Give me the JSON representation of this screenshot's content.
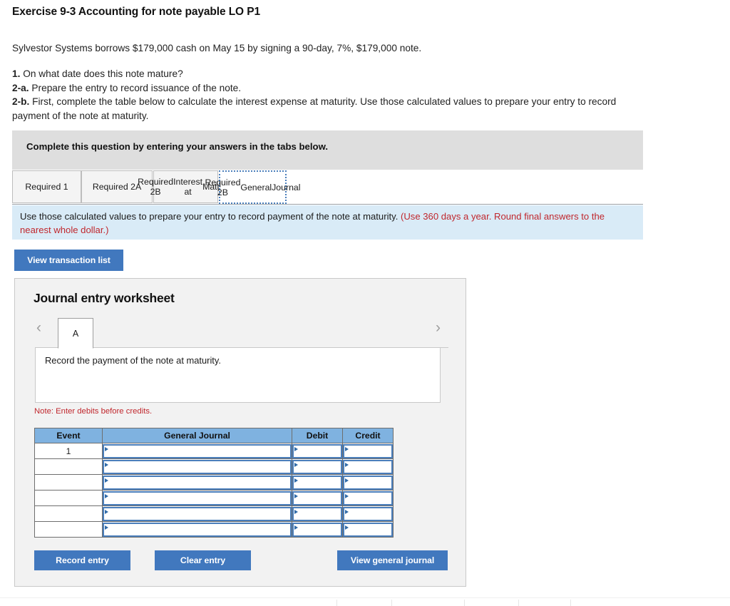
{
  "exercise": {
    "title": "Exercise 9-3 Accounting for note payable LO P1",
    "problem": "Sylvestor Systems borrows $179,000 cash on May 15 by signing a 90-day, 7%, $179,000 note.",
    "requirements": [
      {
        "label": "1.",
        "text": " On what date does this note mature?"
      },
      {
        "label": "2-a.",
        "text": " Prepare the entry to record issuance of the note."
      },
      {
        "label": "2-b.",
        "text": " First, complete the table below to calculate the interest expense at maturity. Use those calculated values to prepare your entry to record payment of the note at maturity."
      }
    ]
  },
  "instruction_banner": {
    "text": "Complete this question by entering your answers in the tabs below."
  },
  "tabs": [
    {
      "id": "tab0",
      "label": "Required 1",
      "active": false
    },
    {
      "id": "tab1",
      "label": "Required 2A",
      "active": false
    },
    {
      "id": "tab2",
      "label": "Required 2B Interest at Maturity",
      "line1": "Required 2B",
      "line2": "Interest at",
      "line3": "Maturity",
      "active": false
    },
    {
      "id": "tab3",
      "label": "Required 2B General Journal",
      "line1": "Required 2B",
      "line2": "General",
      "line3": "Journal",
      "active": true
    }
  ],
  "info_banner": {
    "text": "Use those calculated values to prepare your entry to record payment of the note at maturity. ",
    "hint": "(Use 360 days a year. Round final answers to the nearest whole dollar.)",
    "hint_color": "#c0272d"
  },
  "buttons": {
    "view_transaction_list": "View transaction list",
    "record_entry": "Record entry",
    "clear_entry": "Clear entry",
    "view_general_journal": "View general journal",
    "primary_color": "#4178be"
  },
  "worksheet": {
    "title": "Journal entry worksheet",
    "prev_icon": "chevron-left-icon",
    "next_icon": "chevron-right-icon",
    "entry_tabs": [
      {
        "label": "A",
        "active": true
      }
    ],
    "description": "Record the payment of the note at maturity.",
    "note": "Note: Enter debits before credits.",
    "note_color": "#c0272d",
    "table": {
      "headers": [
        "Event",
        "General Journal",
        "Debit",
        "Credit"
      ],
      "header_color": "#7fb2e0",
      "input_border_color": "#4a7ebb",
      "rows": [
        {
          "event": "1",
          "general_journal": "",
          "debit": "",
          "credit": ""
        },
        {
          "event": "",
          "general_journal": "",
          "debit": "",
          "credit": ""
        },
        {
          "event": "",
          "general_journal": "",
          "debit": "",
          "credit": ""
        },
        {
          "event": "",
          "general_journal": "",
          "debit": "",
          "credit": ""
        },
        {
          "event": "",
          "general_journal": "",
          "debit": "",
          "credit": ""
        },
        {
          "event": "",
          "general_journal": "",
          "debit": "",
          "credit": ""
        }
      ]
    }
  }
}
